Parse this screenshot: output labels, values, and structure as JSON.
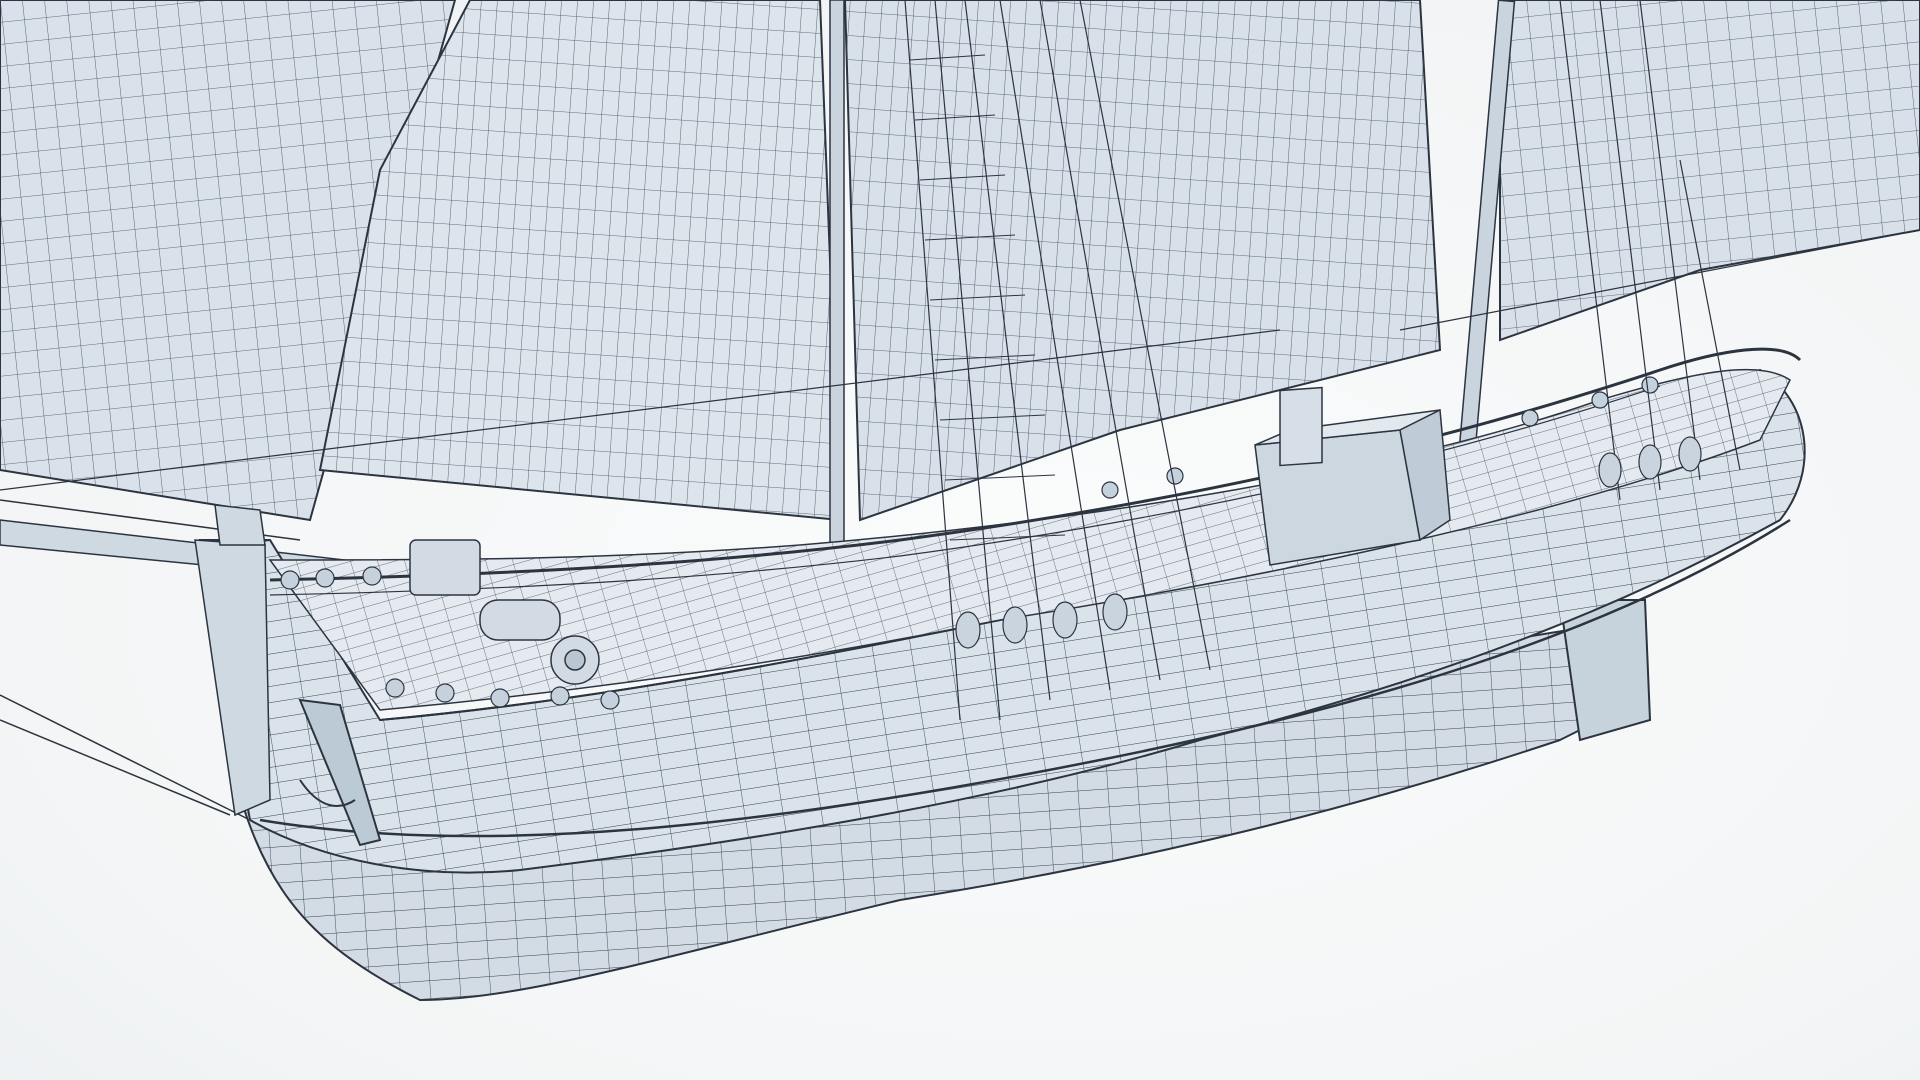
{
  "scene": {
    "subject": "wireframe-render",
    "colors": {
      "background": "#f6f7f8",
      "surface": "#d7e0e8",
      "surface_light": "#e6ecf1",
      "surface_dark": "#b9c7d3",
      "wire": "#2c3440",
      "wire_light": "#5a6674"
    }
  }
}
